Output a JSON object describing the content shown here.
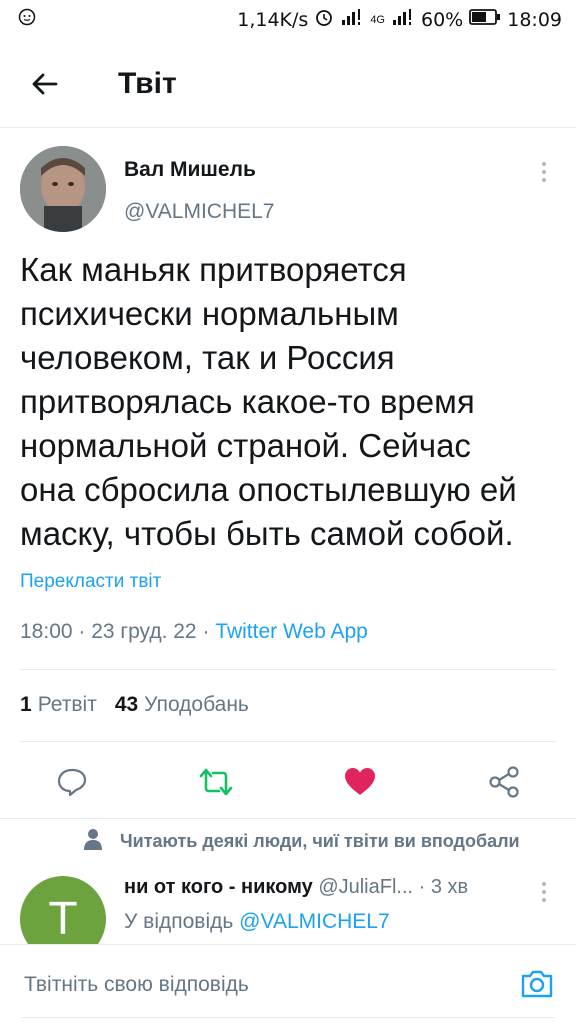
{
  "status_bar": {
    "speed": "1,14K/s",
    "network": "4G",
    "battery": "60%",
    "time": "18:09"
  },
  "header": {
    "title": "Твіт"
  },
  "tweet": {
    "author_name": "Вал Мишель",
    "author_handle": "@VALMICHEL7",
    "text_lines": [
      "Как маньяк притворяется",
      "психически нормальным",
      "человеком, так и Россия",
      "притворялась какое-то время",
      "нормальной страной. Сейчас",
      "она сбросила опостылевшую ей",
      "маску, чтобы быть самой собой."
    ],
    "translate_label": "Перекласти твіт",
    "time": "18:00",
    "date": "23 груд. 22",
    "source": "Twitter Web App",
    "retweets_count": "1",
    "retweets_label": "Ретвіт",
    "likes_count": "43",
    "likes_label": "Уподобань",
    "liked": true
  },
  "reply": {
    "social_context": "Читають деякі люди, чиї твіти ви вподобали",
    "avatar_letter": "T",
    "name": "ни от кого - никому",
    "handle": "@JuliaFl...",
    "time": "3 хв",
    "reply_to_label": "У відповідь",
    "reply_to_mention": "@VALMICHEL7"
  },
  "composer": {
    "placeholder": "Твітніть свою відповідь"
  },
  "colors": {
    "accent": "#1da1f2",
    "like": "#e0245e",
    "retweet": "#17bf63",
    "secondary_text": "#657786"
  }
}
